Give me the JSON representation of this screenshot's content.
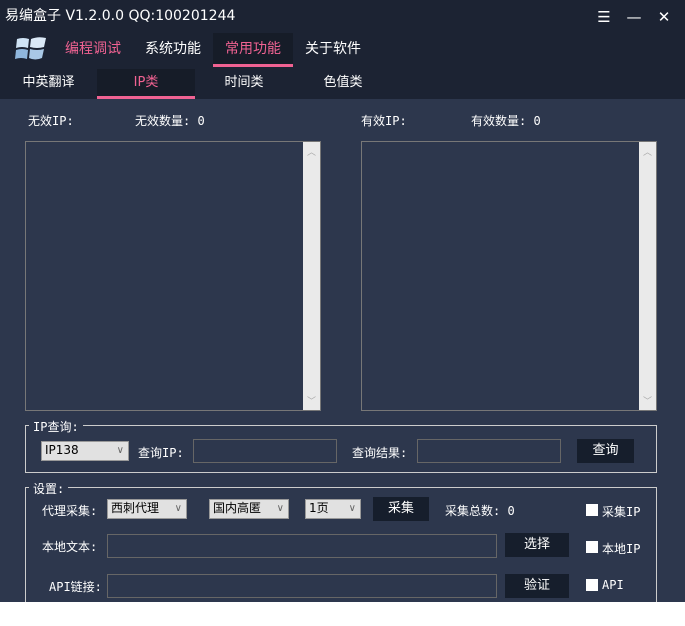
{
  "title": "易编盒子 V1.2.0.0 QQ:100201244",
  "window_controls": {
    "menu": "☰",
    "minimize": "—",
    "close": "✕"
  },
  "menu": [
    "编程调试",
    "系统功能",
    "常用功能",
    "关于软件"
  ],
  "submenu": [
    "中英翻译",
    "IP类",
    "时间类",
    "色值类"
  ],
  "invalid": {
    "label": "无效IP:",
    "count_label": "无效数量:",
    "count": "0"
  },
  "valid": {
    "label": "有效IP:",
    "count_label": "有效数量:",
    "count": "0"
  },
  "ip_query": {
    "group": "IP查询:",
    "source": "IP138",
    "ip_label": "查询IP:",
    "ip_value": "",
    "result_label": "查询结果:",
    "result_value": "",
    "button": "查询"
  },
  "settings": {
    "group": "设置:",
    "proxy_label": "代理采集:",
    "proxy_source": "西刺代理",
    "proxy_type": "国内高匿",
    "pages": "1页",
    "collect_button": "采集",
    "total_label": "采集总数:",
    "total": "0",
    "collect_ip_cb": "采集IP",
    "local_label": "本地文本:",
    "local_value": "",
    "choose_button": "选择",
    "local_ip_cb": "本地IP",
    "api_label": "API链接:",
    "api_value": "",
    "verify_button": "验证",
    "api_cb": "API"
  },
  "colors": {
    "accent": "#f06292",
    "header": "#1c2333",
    "body": "#2d374d"
  }
}
